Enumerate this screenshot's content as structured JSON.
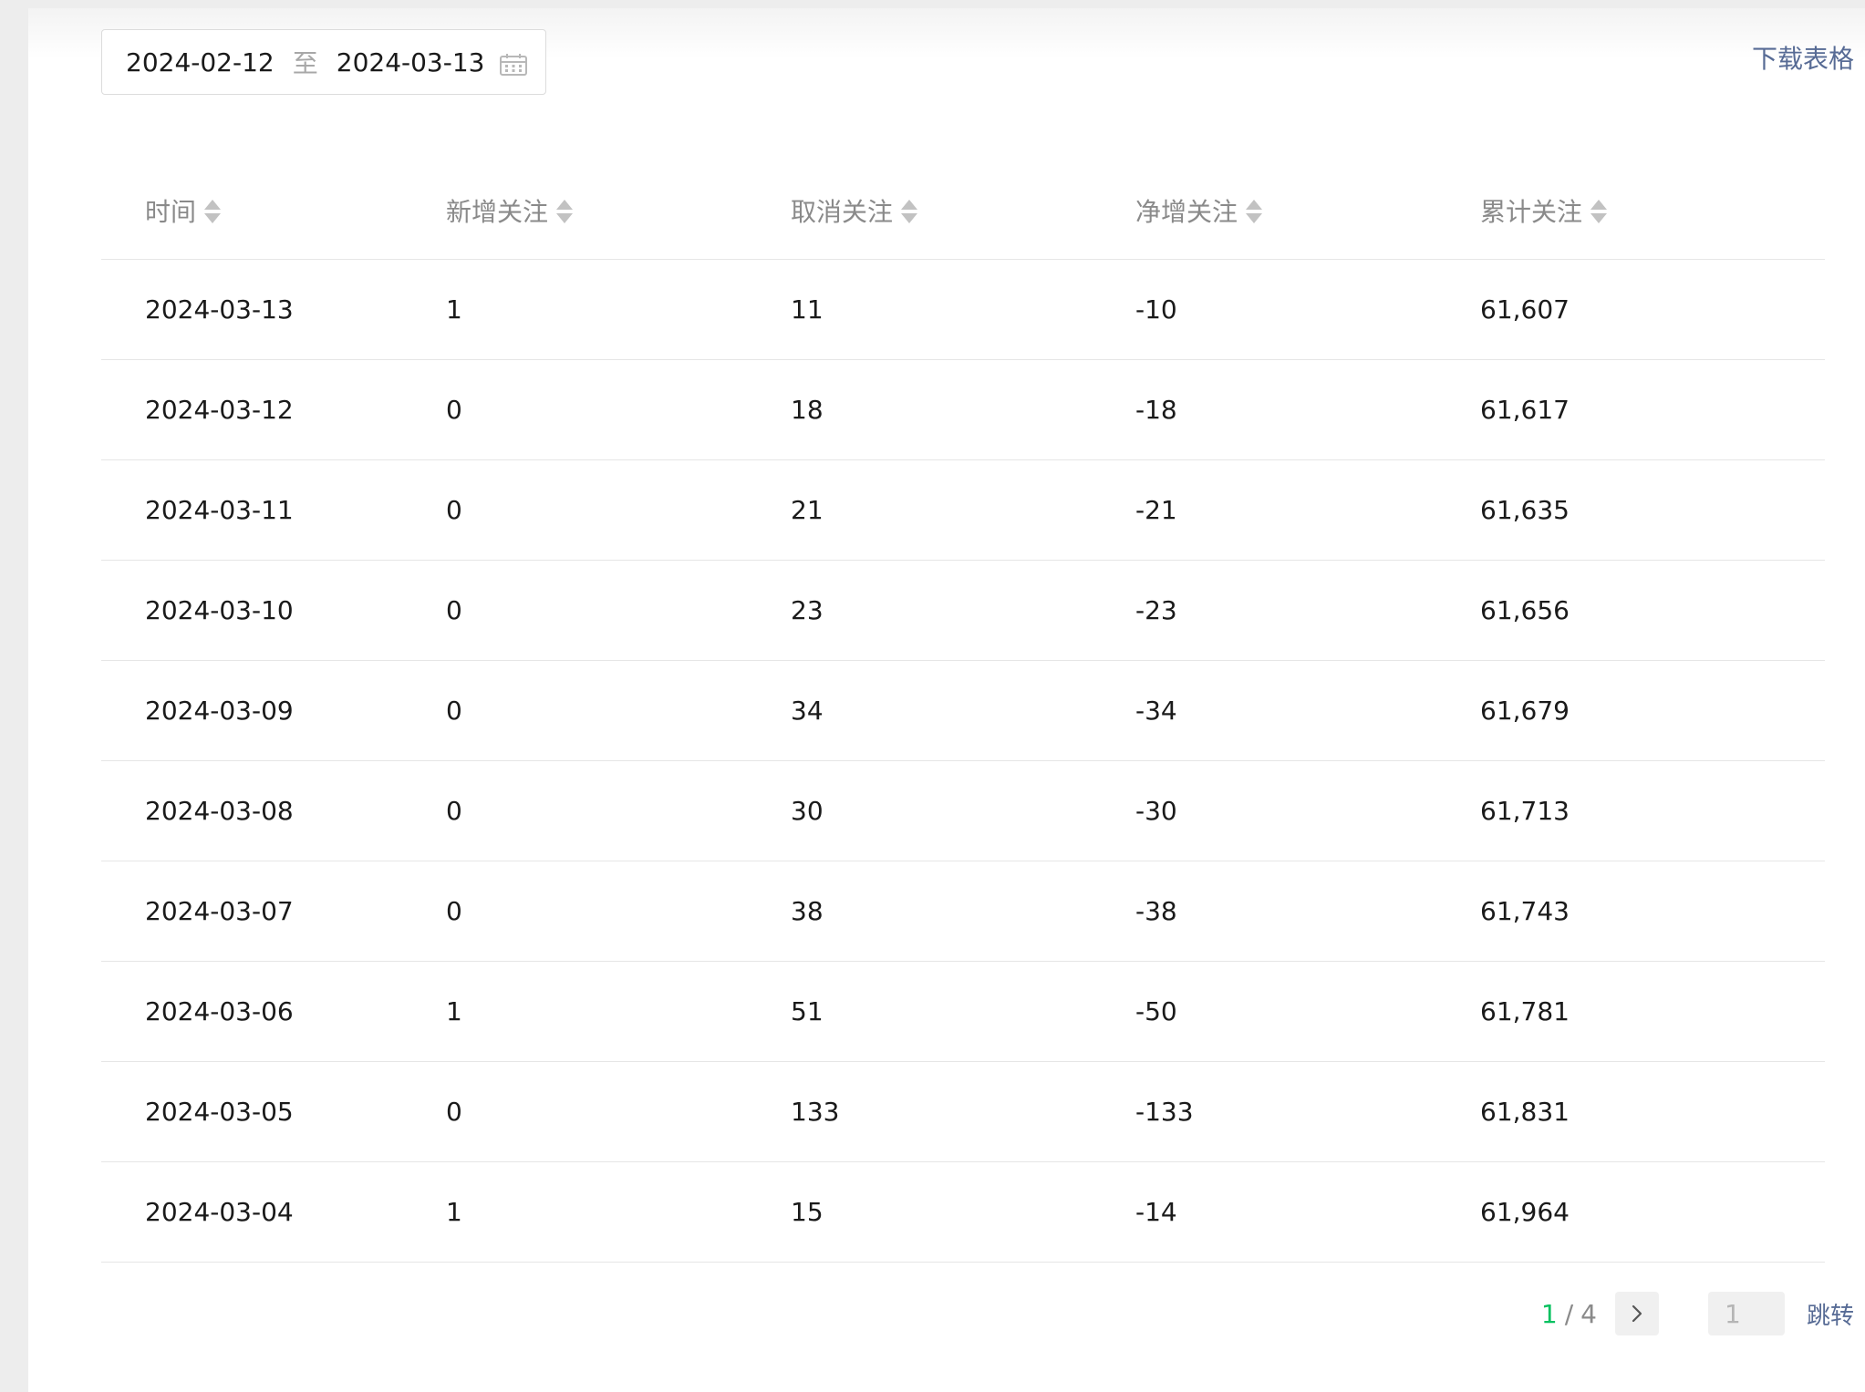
{
  "date_range": {
    "start": "2024-02-12",
    "separator": "至",
    "end": "2024-03-13"
  },
  "download_label": "下载表格",
  "table": {
    "headers": [
      "时间",
      "新增关注",
      "取消关注",
      "净增关注",
      "累计关注"
    ],
    "rows": [
      [
        "2024-03-13",
        "1",
        "11",
        "-10",
        "61,607"
      ],
      [
        "2024-03-12",
        "0",
        "18",
        "-18",
        "61,617"
      ],
      [
        "2024-03-11",
        "0",
        "21",
        "-21",
        "61,635"
      ],
      [
        "2024-03-10",
        "0",
        "23",
        "-23",
        "61,656"
      ],
      [
        "2024-03-09",
        "0",
        "34",
        "-34",
        "61,679"
      ],
      [
        "2024-03-08",
        "0",
        "30",
        "-30",
        "61,713"
      ],
      [
        "2024-03-07",
        "0",
        "38",
        "-38",
        "61,743"
      ],
      [
        "2024-03-06",
        "1",
        "51",
        "-50",
        "61,781"
      ],
      [
        "2024-03-05",
        "0",
        "133",
        "-133",
        "61,831"
      ],
      [
        "2024-03-04",
        "1",
        "15",
        "-14",
        "61,964"
      ]
    ]
  },
  "pagination": {
    "current": "1",
    "separator": "/",
    "total": "4",
    "jump_placeholder": "1",
    "jump_label": "跳转"
  },
  "colors": {
    "accent_green": "#07c160",
    "link_blue": "#576b95"
  },
  "icons": {
    "calendar": "calendar-icon",
    "sort": "sort-icon",
    "next": "chevron-right-icon"
  }
}
